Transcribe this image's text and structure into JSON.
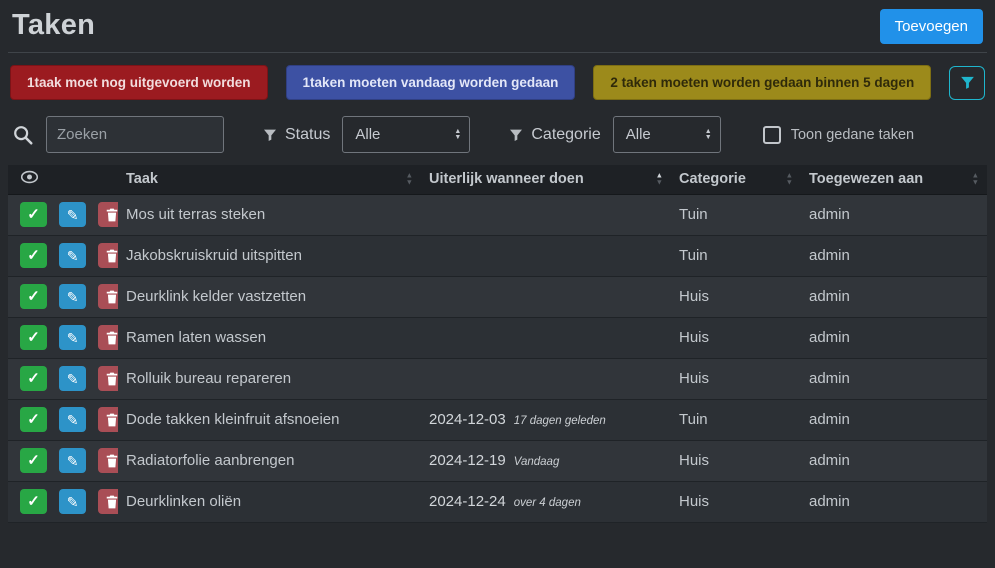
{
  "page": {
    "title": "Taken",
    "add_button": "Toevoegen"
  },
  "alerts": [
    {
      "variant": "danger",
      "text": "1taak moet nog uitgevoerd worden"
    },
    {
      "variant": "info",
      "text": "1taken moeten vandaag worden gedaan"
    },
    {
      "variant": "warning",
      "text": "2 taken moeten worden gedaan binnen 5 dagen"
    }
  ],
  "filters": {
    "search_placeholder": "Zoeken",
    "status_label": "Status",
    "status_value": "Alle",
    "category_label": "Categorie",
    "category_value": "Alle",
    "show_done_label": "Toon gedane taken"
  },
  "table": {
    "headers": {
      "task": "Taak",
      "due": "Uiterlijk wanneer doen",
      "category": "Categorie",
      "assigned": "Toegewezen aan"
    },
    "rows": [
      {
        "task": "Mos uit terras steken",
        "due": "",
        "due_relative": "",
        "category": "Tuin",
        "assigned": "admin",
        "variant": "default"
      },
      {
        "task": "Jakobskruiskruid uitspitten",
        "due": "",
        "due_relative": "",
        "category": "Tuin",
        "assigned": "admin",
        "variant": "default"
      },
      {
        "task": "Deurklink kelder vastzetten",
        "due": "",
        "due_relative": "",
        "category": "Huis",
        "assigned": "admin",
        "variant": "default"
      },
      {
        "task": "Ramen laten wassen",
        "due": "",
        "due_relative": "",
        "category": "Huis",
        "assigned": "admin",
        "variant": "default"
      },
      {
        "task": "Rolluik bureau repareren",
        "due": "",
        "due_relative": "",
        "category": "Huis",
        "assigned": "admin",
        "variant": "default"
      },
      {
        "task": "Dode takken kleinfruit afsnoeien",
        "due": "2024-12-03",
        "due_relative": "17 dagen geleden",
        "category": "Tuin",
        "assigned": "admin",
        "variant": "danger"
      },
      {
        "task": "Radiatorfolie aanbrengen",
        "due": "2024-12-19",
        "due_relative": "Vandaag",
        "category": "Huis",
        "assigned": "admin",
        "variant": "info"
      },
      {
        "task": "Deurklinken oliën",
        "due": "2024-12-24",
        "due_relative": "over 4 dagen",
        "category": "Huis",
        "assigned": "admin",
        "variant": "warning"
      }
    ]
  },
  "colors": {
    "accent_blue": "#2191e9",
    "danger_banner": "#9b1b20",
    "info_banner": "#3d51a3",
    "warning_banner": "#9c8a1b",
    "danger_row": "#58242a",
    "info_row": "#1c4150",
    "warning_row": "#4e440f",
    "done_button": "#28a745",
    "edit_button": "#2d93c8",
    "delete_button": "#a94e56"
  }
}
